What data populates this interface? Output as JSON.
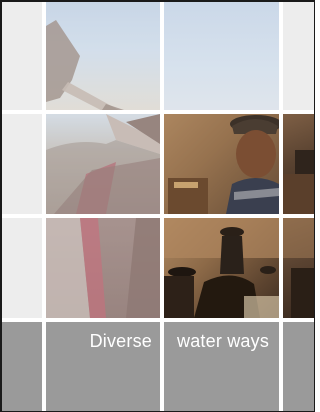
{
  "caption": {
    "word1": "Diverse",
    "word2": "water ways"
  },
  "colors": {
    "frame": "#1a1a1a",
    "gutter": "#ffffff",
    "pale_panel": "#ededed",
    "caption_band": "#9a9a9a",
    "caption_text": "#ffffff"
  }
}
